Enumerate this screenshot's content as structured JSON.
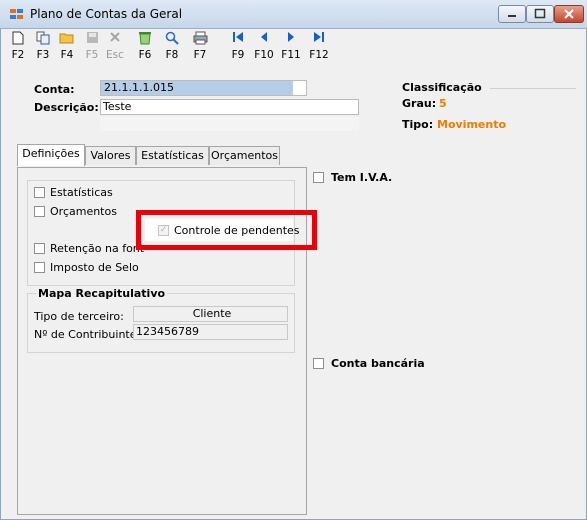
{
  "window": {
    "title": "Plano de Contas da Geral"
  },
  "toolbar": [
    {
      "key": "F2",
      "icon": "new-document-icon",
      "disabled": false
    },
    {
      "key": "F3",
      "icon": "copy-icon",
      "disabled": false
    },
    {
      "key": "F4",
      "icon": "open-folder-icon",
      "disabled": false
    },
    {
      "key": "F5",
      "icon": "save-icon",
      "disabled": true
    },
    {
      "key": "Esc",
      "icon": "cancel-icon",
      "disabled": true
    },
    {
      "key": "F6",
      "icon": "recycle-icon",
      "disabled": false
    },
    {
      "key": "F8",
      "icon": "search-icon",
      "disabled": false
    },
    {
      "key": "F7",
      "icon": "print-icon",
      "disabled": false
    },
    {
      "key": "F9",
      "icon": "first-record-icon",
      "disabled": false
    },
    {
      "key": "F10",
      "icon": "previous-record-icon",
      "disabled": false
    },
    {
      "key": "F11",
      "icon": "next-record-icon",
      "disabled": false
    },
    {
      "key": "F12",
      "icon": "last-record-icon",
      "disabled": false
    }
  ],
  "form": {
    "conta_label": "Conta:",
    "conta_value": "21.1.1.1.015",
    "descricao_label": "Descrição:",
    "descricao_value": "Teste"
  },
  "classificacao": {
    "heading": "Classificação",
    "grau_label": "Grau:",
    "grau_value": "5",
    "tipo_label": "Tipo:",
    "tipo_value": "Movimento"
  },
  "tabs": [
    "Definições",
    "Valores",
    "Estatísticas",
    "Orçamentos"
  ],
  "definicoes": {
    "estatisticas": "Estatísticas",
    "orcamentos": "Orçamentos",
    "controle_pendentes": "Controle de pendentes",
    "retencao": "Retenção na font",
    "imposto_selo": "Imposto de Selo"
  },
  "mapa": {
    "heading": "Mapa Recapitulativo",
    "tipo_terceiro_label": "Tipo de terceiro:",
    "tipo_terceiro_value": "Cliente",
    "contribuinte_label": "Nº de Contribuinte:",
    "contribuinte_value": "123456789"
  },
  "right": {
    "tem_iva": "Tem I.V.A.",
    "conta_bancaria": "Conta bancária"
  },
  "colors": {
    "accent": "#f07c00",
    "highlight": "#e8000b"
  }
}
